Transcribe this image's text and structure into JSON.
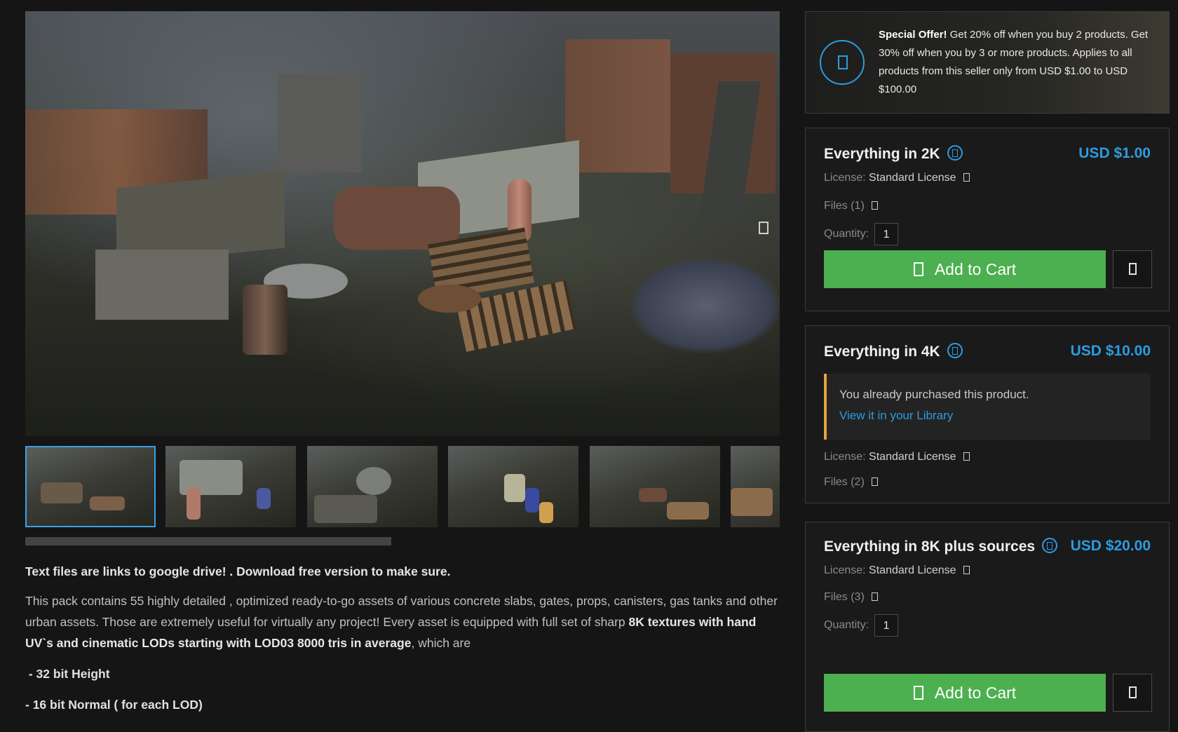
{
  "offer": {
    "headline": "Special Offer!",
    "text": " Get 20% off when you buy 2 products. Get 30% off when you by 3 or more products. Applies to all products from this seller only from USD $1.00 to USD $100.00",
    "icon": "tag-icon"
  },
  "gallery": {
    "thumbnail_count": 6,
    "active_thumbnail": 1
  },
  "description": {
    "lead": "Text files are links to google drive! . Download free version to make sure.",
    "body_part1": "This pack contains 55 highly detailed , optimized ready-to-go assets of various concrete slabs, gates, props, canisters, gas tanks and other urban assets. Those are extremely useful for virtually any project! Every asset is equipped with full set of sharp ",
    "body_bold": "8K textures with hand UV`s and cinematic LODs starting with LOD03 8000 tris in average",
    "body_part2": ", which are",
    "list": [
      " - 32 bit Height",
      "- 16 bit Normal ( for each LOD)"
    ]
  },
  "products": [
    {
      "title": "Everything in 2K",
      "price": "USD $1.00",
      "license_label": "License:",
      "license_value": "Standard License",
      "files": "Files (1)",
      "quantity_label": "Quantity:",
      "quantity": "1",
      "add_to_cart": "Add to Cart"
    },
    {
      "title": "Everything in 4K",
      "price": "USD $10.00",
      "purchased_msg": "You already purchased this product.",
      "library_link": "View it in your Library",
      "license_label": "License:",
      "license_value": "Standard License",
      "files": "Files (2)"
    },
    {
      "title": "Everything in 8K plus sources",
      "price": "USD $20.00",
      "license_label": "License:",
      "license_value": "Standard License",
      "files": "Files (3)",
      "quantity_label": "Quantity:",
      "quantity": "1",
      "add_to_cart": "Add to Cart"
    }
  ],
  "colors": {
    "accent": "#2d9be0",
    "cart_green": "#4caf50",
    "notice_orange": "#e6a23c",
    "background": "#151515"
  }
}
